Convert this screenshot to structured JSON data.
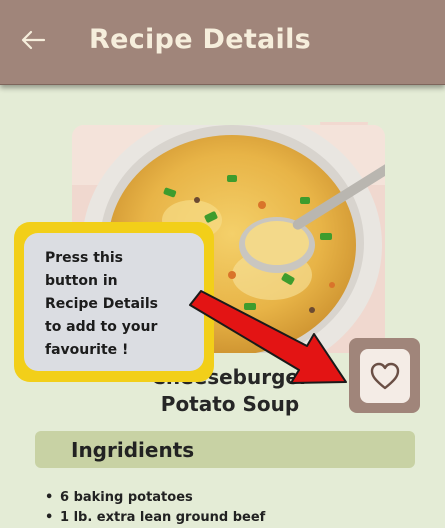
{
  "header": {
    "title": "Recipe Details",
    "back_icon": "arrow-left-icon"
  },
  "recipe": {
    "name_line1": "Cheeseburger",
    "name_line2": "Potato Soup",
    "image_description": "bowl of cheeseburger potato soup with spoon"
  },
  "favourite": {
    "icon": "heart-outline-icon"
  },
  "ingredients": {
    "heading": "Ingridients",
    "items": [
      "6 baking potatoes",
      "1 lb. extra lean ground beef"
    ]
  },
  "callout": {
    "lines": [
      "Press this",
      "button in",
      "Recipe Details",
      "to add to your",
      "favourite !"
    ]
  },
  "colors": {
    "appbar": "#a0857a",
    "background": "#e4ecd6",
    "ingredients_bar": "#c8d2a4",
    "callout_border": "#f2cf19",
    "arrow": "#e31414"
  }
}
